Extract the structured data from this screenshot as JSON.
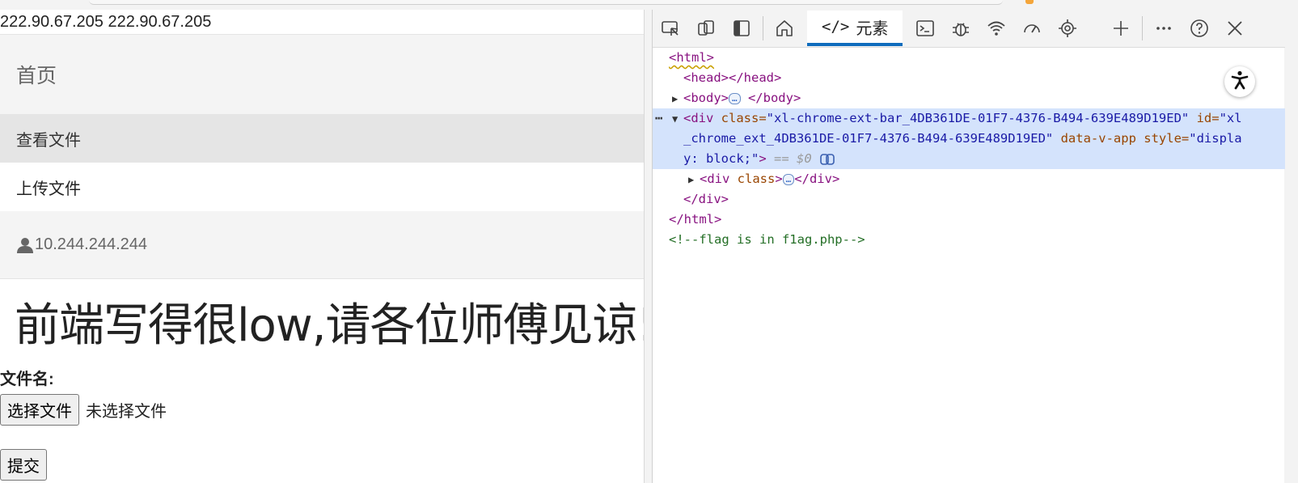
{
  "page": {
    "ip_text": "222.90.67.205 222.90.67.205",
    "nav": {
      "home": "首页",
      "view_files": "查看文件",
      "upload_files": "上传文件",
      "user_ip": "10.244.244.244"
    },
    "heading": "前端写得很low,请各位师傅见谅!",
    "file_label": "文件名:",
    "choose_button": "选择文件",
    "no_file_text": "未选择文件",
    "submit_button": "提交"
  },
  "devtools": {
    "elements_tab": "元素",
    "tree": {
      "html_open": "<html>",
      "head_tag": "<head></head>",
      "body_open": "<body>",
      "body_close": "</body>",
      "div_open": "<div",
      "div_class_attr": " class=",
      "div_class_val": "\"xl-chrome-ext-bar_4DB361DE-01F7-4376-B494-639E489D19ED\"",
      "div_id_attr": " id=",
      "div_id_val_a": "\"xl",
      "div_id_val_b": "_chrome_ext_4DB361DE-01F7-4376-B494-639E489D19ED\"",
      "div_data_attr": " data-v-app",
      "div_style_attr": " style=",
      "div_style_val_a": "\"displa",
      "div_style_val_b": "y: block;\"",
      "div_close_bracket": ">",
      "eq_marker": "== $0",
      "inner_div_open": "<div",
      "inner_div_class": " class",
      "inner_div_gt": ">",
      "inner_div_close": "</div>",
      "div_end": "</div>",
      "html_close": "</html>",
      "comment": "<!--flag is in f1ag.php-->",
      "ellipsis": "…"
    }
  },
  "colors": {
    "accent_tab": "#0f6cbd",
    "selected_row": "#d4e3fc",
    "tag": "#881280",
    "attr": "#994500",
    "value": "#1a1aa6",
    "comment": "#236e25"
  }
}
